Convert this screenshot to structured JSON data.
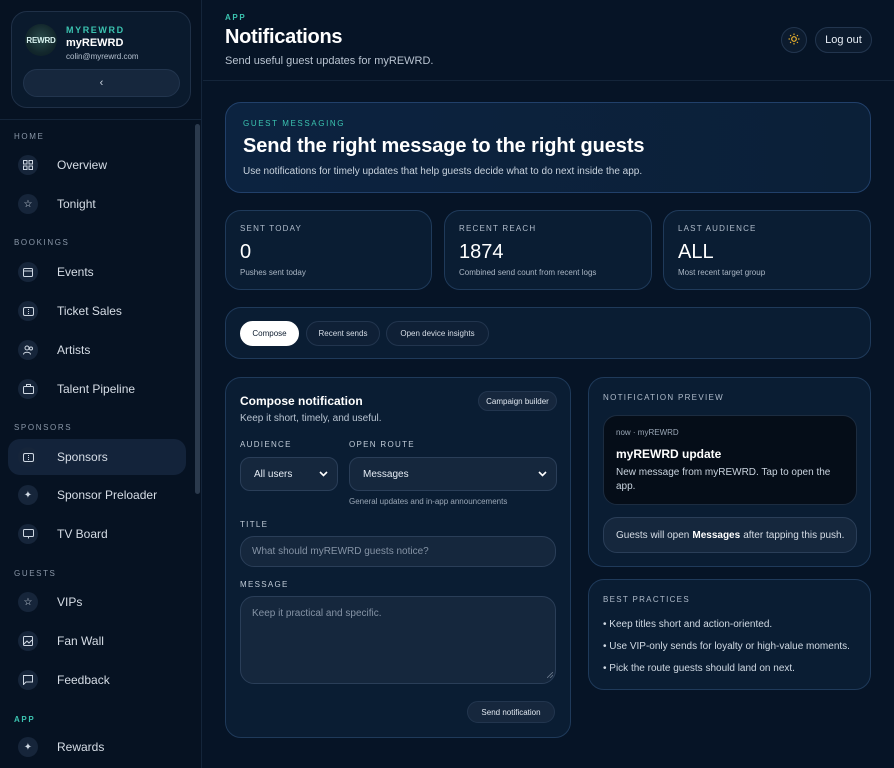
{
  "sidebar": {
    "brand_kicker": "MYREWRD",
    "brand_name": "myREWRD",
    "brand_email": "colin@myrewrd.com",
    "logo_text": "REWRD",
    "collapse_glyph": "‹",
    "sections": {
      "home": "HOME",
      "bookings": "BOOKINGS",
      "sponsors": "SPONSORS",
      "guests": "GUESTS",
      "app": "APP"
    },
    "items": {
      "overview": "Overview",
      "tonight": "Tonight",
      "events": "Events",
      "ticket_sales": "Ticket Sales",
      "artists": "Artists",
      "talent_pipeline": "Talent Pipeline",
      "sponsors": "Sponsors",
      "sponsor_preloader": "Sponsor Preloader",
      "tv_board": "TV Board",
      "vips": "VIPs",
      "fan_wall": "Fan Wall",
      "feedback": "Feedback",
      "rewards": "Rewards"
    },
    "active_item": "Sponsors"
  },
  "header": {
    "kicker": "APP",
    "title": "Notifications",
    "subtitle": "Send useful guest updates for myREWRD.",
    "logout_label": "Log out"
  },
  "hero": {
    "kicker": "GUEST MESSAGING",
    "title": "Send the right message to the right guests",
    "text": "Use notifications for timely updates that help guests decide what to do next inside the app."
  },
  "stats": {
    "sent_today": {
      "label": "SENT TODAY",
      "value": "0",
      "sub": "Pushes sent today"
    },
    "recent_reach": {
      "label": "RECENT REACH",
      "value": "1874",
      "sub": "Combined send count from recent logs"
    },
    "last_audience": {
      "label": "LAST AUDIENCE",
      "value": "ALL",
      "sub": "Most recent target group"
    }
  },
  "tabs": {
    "compose": "Compose",
    "recent_sends": "Recent sends",
    "device_insights": "Open device insights"
  },
  "compose": {
    "title": "Compose notification",
    "subtitle": "Keep it short, timely, and useful.",
    "campaign_builder": "Campaign builder",
    "audience_label": "AUDIENCE",
    "audience_value": "All users",
    "route_label": "OPEN ROUTE",
    "route_value": "Messages",
    "route_hint": "General updates and in-app announcements",
    "title_label": "TITLE",
    "title_placeholder": "What should myREWRD guests notice?",
    "message_label": "MESSAGE",
    "message_placeholder": "Keep it practical and specific.",
    "send_label": "Send notification"
  },
  "preview": {
    "kicker": "NOTIFICATION PREVIEW",
    "meta": "now · myREWRD",
    "push_title": "myREWRD update",
    "push_body": "New message from myREWRD. Tap to open the app.",
    "route_prefix": "Guests will open",
    "route_name": "Messages",
    "route_suffix": "after tapping this push."
  },
  "tips": {
    "kicker": "BEST PRACTICES",
    "items": [
      "• Keep titles short and action-oriented.",
      "• Use VIP-only sends for loyalty or high-value moments.",
      "• Pick the route guests should land on next."
    ]
  },
  "colors": {
    "background": "#061426",
    "accent": "#3bc3b0",
    "card": "#0a1d33",
    "theme_icon": "#f0b52c"
  }
}
